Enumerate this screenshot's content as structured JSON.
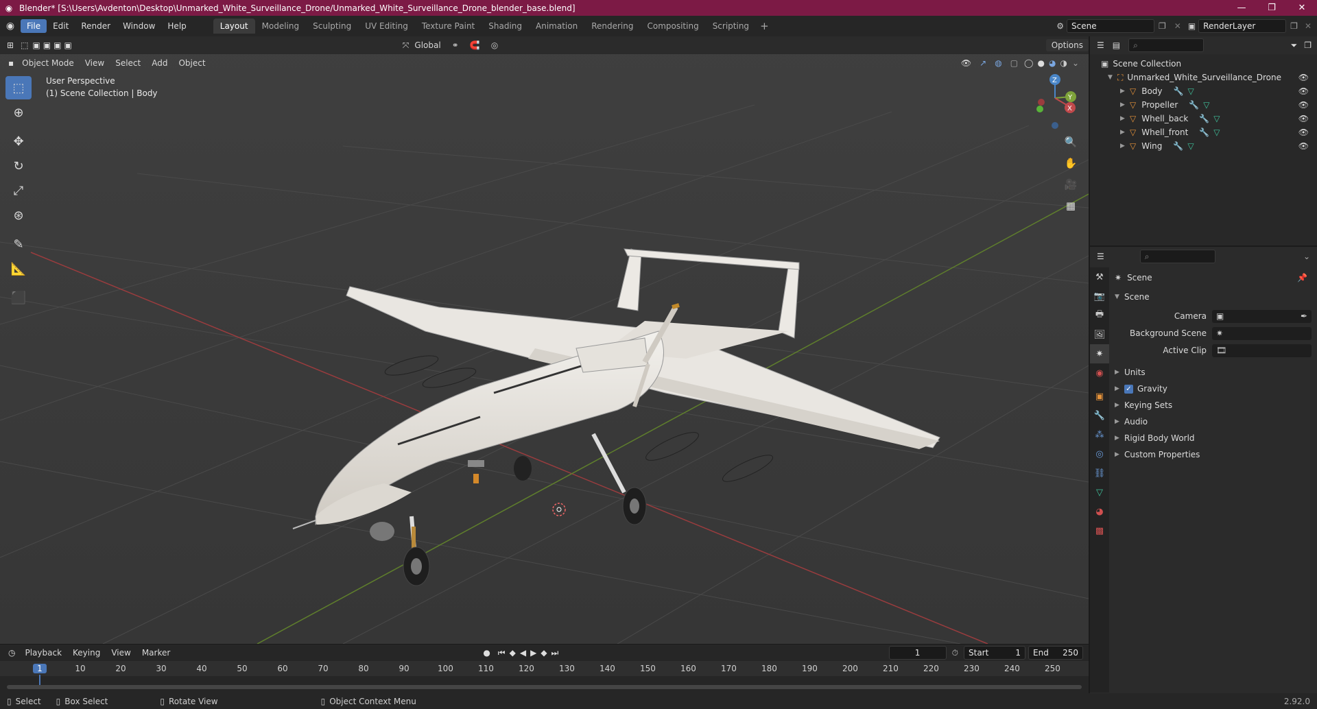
{
  "window": {
    "title": "Blender* [S:\\Users\\Avdenton\\Desktop\\Unmarked_White_Surveillance_Drone/Unmarked_White_Surveillance_Drone_blender_base.blend]",
    "minimize": "—",
    "restore": "❐",
    "close": "✕"
  },
  "menu": {
    "file": "File",
    "edit": "Edit",
    "render": "Render",
    "window": "Window",
    "help": "Help"
  },
  "workspaces": [
    "Layout",
    "Modeling",
    "Sculpting",
    "UV Editing",
    "Texture Paint",
    "Shading",
    "Animation",
    "Rendering",
    "Compositing",
    "Scripting"
  ],
  "top_right": {
    "scene": "Scene",
    "render_layer": "RenderLayer"
  },
  "viewport": {
    "mode": "Object Mode",
    "menus": [
      "View",
      "Select",
      "Add",
      "Object"
    ],
    "transform_orientation": "Global",
    "options": "Options",
    "info_line1": "User Perspective",
    "info_line2": "(1) Scene Collection | Body",
    "gizmo_labels": {
      "z": "Z",
      "y": "Y",
      "x": "X"
    }
  },
  "outliner": {
    "root": "Scene Collection",
    "collection": "Unmarked_White_Surveillance_Drone",
    "objects": [
      "Body",
      "Propeller",
      "Whell_back",
      "Whell_front",
      "Wing"
    ]
  },
  "properties": {
    "breadcrumb": "Scene",
    "panel": "Scene",
    "camera_label": "Camera",
    "background_label": "Background Scene",
    "active_clip_label": "Active Clip",
    "subpanels": [
      "Units",
      "Gravity",
      "Keying Sets",
      "Audio",
      "Rigid Body World",
      "Custom Properties"
    ],
    "gravity_checked": true
  },
  "timeline": {
    "menus": [
      "Playback",
      "Keying",
      "View",
      "Marker"
    ],
    "current_frame": "1",
    "start_label": "Start",
    "start": "1",
    "end_label": "End",
    "end": "250",
    "ruler": [
      "1",
      "10",
      "20",
      "30",
      "40",
      "50",
      "60",
      "70",
      "80",
      "90",
      "100",
      "110",
      "120",
      "130",
      "140",
      "150",
      "160",
      "170",
      "180",
      "190",
      "200",
      "210",
      "220",
      "230",
      "240",
      "250"
    ]
  },
  "statusbar": {
    "select": "Select",
    "box_select": "Box Select",
    "rotate": "Rotate View",
    "context": "Object Context Menu",
    "version": "2.92.0"
  },
  "colors": {
    "accent": "#4a77b8",
    "title_bar": "#7c1a45",
    "viewport_bg": "#3a3a3a",
    "x_axis": "#c0494b",
    "y_axis": "#7ea33a",
    "object_orange": "#e6933a"
  }
}
